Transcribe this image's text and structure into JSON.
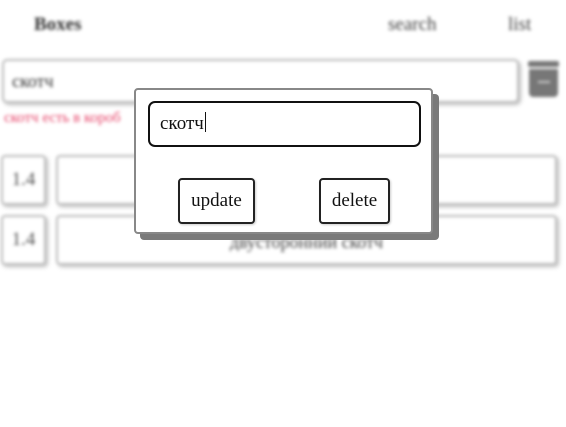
{
  "nav": {
    "title": "Boxes",
    "search_label": "search",
    "list_label": "list"
  },
  "search": {
    "value": "скотч"
  },
  "warning": {
    "text": "скотч есть в короб"
  },
  "rows": [
    {
      "number": "1.4",
      "name": ""
    },
    {
      "number": "1.4",
      "name": "двусторонний скотч"
    }
  ],
  "modal": {
    "input_value": "скотч",
    "update_label": "update",
    "delete_label": "delete"
  },
  "icons": {
    "trash": "trash-icon"
  }
}
